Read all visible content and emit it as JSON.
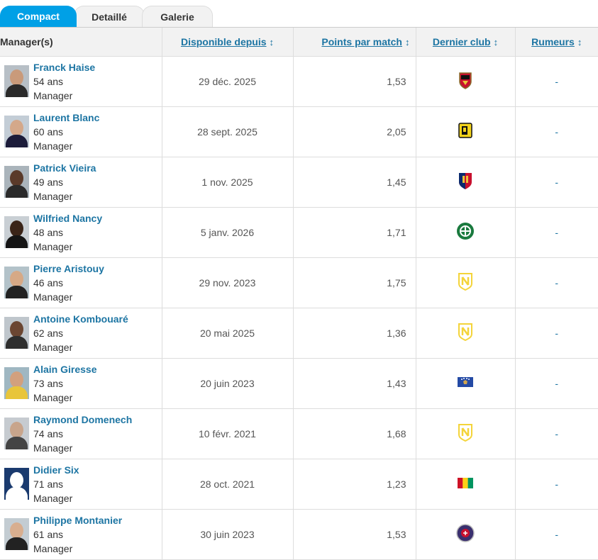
{
  "tabs": [
    "Compact",
    "Detaillé",
    "Galerie"
  ],
  "headers": {
    "manager": "Manager(s)",
    "available": "Disponible depuis",
    "ppm": "Points par match",
    "club": "Dernier club",
    "rumours": "Rumeurs",
    "sort_icon": "↕"
  },
  "rows": [
    {
      "name": "Franck Haise",
      "age": "54 ans",
      "role": "Manager",
      "available": "29 déc. 2025",
      "ppm": "1,53",
      "club_icon": "ogc-nice-crest",
      "rumours": "-"
    },
    {
      "name": "Laurent Blanc",
      "age": "60 ans",
      "role": "Manager",
      "available": "28 sept. 2025",
      "ppm": "2,05",
      "club_icon": "al-ittihad-crest",
      "rumours": "-"
    },
    {
      "name": "Patrick Vieira",
      "age": "49 ans",
      "role": "Manager",
      "available": "1 nov. 2025",
      "ppm": "1,45",
      "club_icon": "genoa-crest",
      "rumours": "-"
    },
    {
      "name": "Wilfried Nancy",
      "age": "48 ans",
      "role": "Manager",
      "available": "5 janv. 2026",
      "ppm": "1,71",
      "club_icon": "celtic-crest",
      "rumours": "-"
    },
    {
      "name": "Pierre Aristouy",
      "age": "46 ans",
      "role": "Manager",
      "available": "29 nov. 2023",
      "ppm": "1,75",
      "club_icon": "fc-nantes-crest",
      "rumours": "-"
    },
    {
      "name": "Antoine Kombouaré",
      "age": "62 ans",
      "role": "Manager",
      "available": "20 mai 2025",
      "ppm": "1,36",
      "club_icon": "fc-nantes-crest",
      "rumours": "-"
    },
    {
      "name": "Alain Giresse",
      "age": "73 ans",
      "role": "Manager",
      "available": "20 juin 2023",
      "ppm": "1,43",
      "club_icon": "kosovo-flag",
      "rumours": "-"
    },
    {
      "name": "Raymond Domenech",
      "age": "74 ans",
      "role": "Manager",
      "available": "10 févr. 2021",
      "ppm": "1,68",
      "club_icon": "fc-nantes-crest",
      "rumours": "-"
    },
    {
      "name": "Didier Six",
      "age": "71 ans",
      "role": "Manager",
      "available": "28 oct. 2021",
      "ppm": "1,23",
      "club_icon": "guinea-flag",
      "rumours": "-"
    },
    {
      "name": "Philippe Montanier",
      "age": "61 ans",
      "role": "Manager",
      "available": "30 juin 2023",
      "ppm": "1,53",
      "club_icon": "toulouse-fc-crest",
      "rumours": "-"
    }
  ],
  "colors": {
    "accent": "#00a0e6",
    "link": "#1d75a3"
  }
}
